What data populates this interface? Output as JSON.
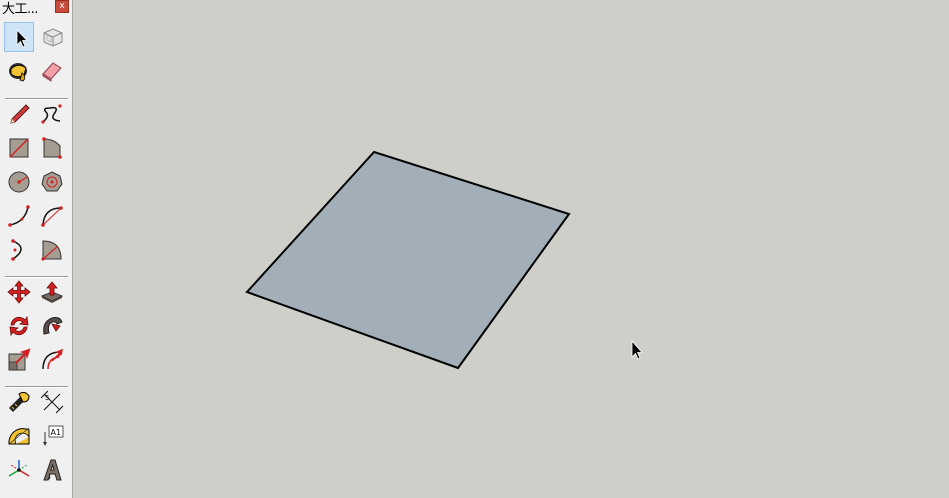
{
  "palette": {
    "title": "大工...",
    "close_label": "x"
  },
  "tools": [
    {
      "name": "select-tool",
      "icon": "arrow-cursor-icon",
      "selected": true
    },
    {
      "name": "make-component-tool",
      "icon": "component-box-icon",
      "selected": false
    },
    {
      "name": "paint-bucket-tool",
      "icon": "paint-bucket-icon",
      "selected": false
    },
    {
      "name": "eraser-tool",
      "icon": "eraser-icon",
      "selected": false
    },
    {
      "name": "line-tool",
      "icon": "pencil-icon",
      "selected": false
    },
    {
      "name": "freehand-tool",
      "icon": "freehand-curve-icon",
      "selected": false
    },
    {
      "name": "rectangle-tool",
      "icon": "rectangle-icon",
      "selected": false
    },
    {
      "name": "rotated-rectangle-tool",
      "icon": "rotated-rectangle-icon",
      "selected": false
    },
    {
      "name": "circle-tool",
      "icon": "circle-icon",
      "selected": false
    },
    {
      "name": "polygon-tool",
      "icon": "polygon-icon",
      "selected": false
    },
    {
      "name": "arc-tool",
      "icon": "arc-icon",
      "selected": false
    },
    {
      "name": "two-point-arc-tool",
      "icon": "two-point-arc-icon",
      "selected": false
    },
    {
      "name": "three-point-arc-tool",
      "icon": "three-point-arc-icon",
      "selected": false
    },
    {
      "name": "pie-tool",
      "icon": "pie-icon",
      "selected": false
    },
    {
      "name": "move-tool",
      "icon": "move-arrows-icon",
      "selected": false
    },
    {
      "name": "push-pull-tool",
      "icon": "push-pull-icon",
      "selected": false
    },
    {
      "name": "rotate-tool",
      "icon": "rotate-arrows-icon",
      "selected": false
    },
    {
      "name": "follow-me-tool",
      "icon": "follow-me-icon",
      "selected": false
    },
    {
      "name": "scale-tool",
      "icon": "scale-icon",
      "selected": false
    },
    {
      "name": "offset-tool",
      "icon": "offset-icon",
      "selected": false
    },
    {
      "name": "tape-measure-tool",
      "icon": "tape-measure-icon",
      "selected": false
    },
    {
      "name": "dimension-tool",
      "icon": "dimension-icon",
      "selected": false
    },
    {
      "name": "protractor-tool",
      "icon": "protractor-icon",
      "selected": false
    },
    {
      "name": "text-tool",
      "icon": "text-label-icon",
      "selected": false,
      "label": "A1"
    },
    {
      "name": "axes-tool",
      "icon": "axes-icon",
      "selected": false
    },
    {
      "name": "3d-text-tool",
      "icon": "3d-text-icon",
      "selected": false
    }
  ],
  "colors": {
    "canvas_background": "#cfcfca",
    "face_fill": "#a3afb8",
    "edge_color": "#000000",
    "palette_background": "#f0f0f0",
    "accent_red": "#d42020"
  }
}
